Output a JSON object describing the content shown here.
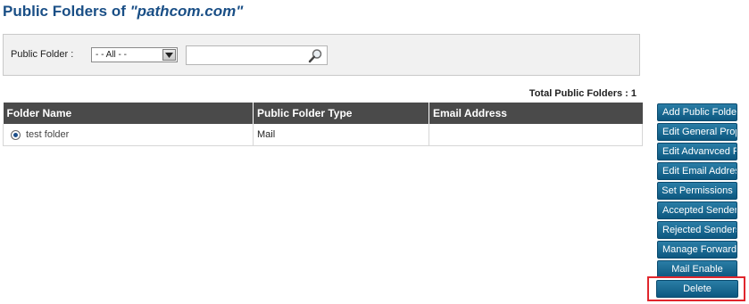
{
  "header": {
    "title_prefix": "Public Folders of ",
    "domain": "\"pathcom.com\""
  },
  "filter": {
    "label": "Public Folder :",
    "select_value": "- - All - -",
    "search_value": "",
    "search_placeholder": ""
  },
  "summary": {
    "total_label": "Total Public Folders : 1"
  },
  "table": {
    "columns": [
      "Folder Name",
      "Public Folder Type",
      "Email Address"
    ],
    "rows": [
      {
        "name": "test folder",
        "type": "Mail",
        "email": "",
        "selected": true
      }
    ]
  },
  "actions": [
    "Add Public Folder",
    "Edit General Properties",
    "Edit Advanvced Properties",
    "Edit Email Addresses",
    "Set Permissions",
    "Accepted Senders",
    "Rejected Senders",
    "Manage Forwarding",
    "Mail Enable"
  ],
  "delete_label": "Delete",
  "colors": {
    "title": "#1a4f86",
    "table_header": "#4a4a4a",
    "button": "#0d5880",
    "highlight": "#e0262d"
  }
}
